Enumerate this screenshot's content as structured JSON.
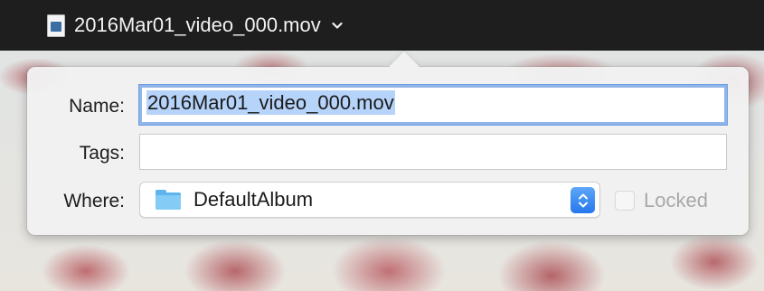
{
  "window": {
    "title": "2016Mar01_video_000.mov"
  },
  "popover": {
    "name_label": "Name:",
    "name_value": "2016Mar01_video_000.mov",
    "tags_label": "Tags:",
    "tags_value": "",
    "where_label": "Where:",
    "where_value": "DefaultAlbum",
    "locked_label": "Locked",
    "locked_checked": false
  },
  "icons": {
    "document": "video-document-icon",
    "chevron": "chevron-down-icon",
    "folder": "folder-icon",
    "stepper": "up-down-stepper-icon"
  },
  "colors": {
    "accent": "#2578ec",
    "selection": "#b6d3f9",
    "focus_ring": "#90b5e8",
    "folder": "#5db4ee",
    "topbar": "#1e1e1e"
  }
}
